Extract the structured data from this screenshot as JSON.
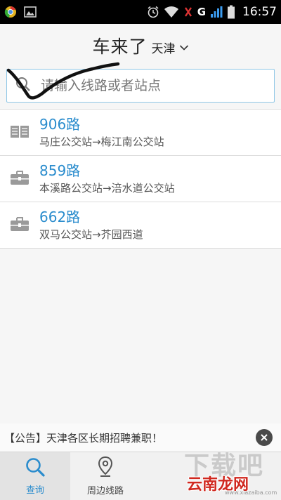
{
  "status_bar": {
    "time": "16:57",
    "network": "G",
    "icons": [
      "chrome-icon",
      "image-icon",
      "alarm-icon",
      "wifi-icon",
      "no-sim-icon",
      "signal-icon",
      "battery-icon"
    ]
  },
  "header": {
    "title": "车来了",
    "city": "天津"
  },
  "search": {
    "placeholder": "请输入线路或者站点"
  },
  "routes": [
    {
      "name": "906路",
      "stops": "马庄公交站→梅江南公交站",
      "icon": "book-icon"
    },
    {
      "name": "859路",
      "stops": "本溪路公交站→涪水道公交站",
      "icon": "briefcase-icon"
    },
    {
      "name": "662路",
      "stops": "双马公交站→芥园西道",
      "icon": "briefcase-icon"
    }
  ],
  "notice": {
    "text": "【公告】天津各区长期招聘兼职！"
  },
  "tabs": [
    {
      "label": "查询",
      "icon": "search-icon",
      "active": true
    },
    {
      "label": "周边线路",
      "icon": "location-pin-icon",
      "active": false
    }
  ],
  "watermark": {
    "big": "下载吧",
    "main": "云南龙网",
    "small": "www.xiazaiba.com"
  },
  "colors": {
    "accent": "#2a8ccd",
    "status_bar": "#000000",
    "background": "#f6f6f6",
    "search_border": "#8ec6e6",
    "watermark_red": "#d0281f"
  }
}
